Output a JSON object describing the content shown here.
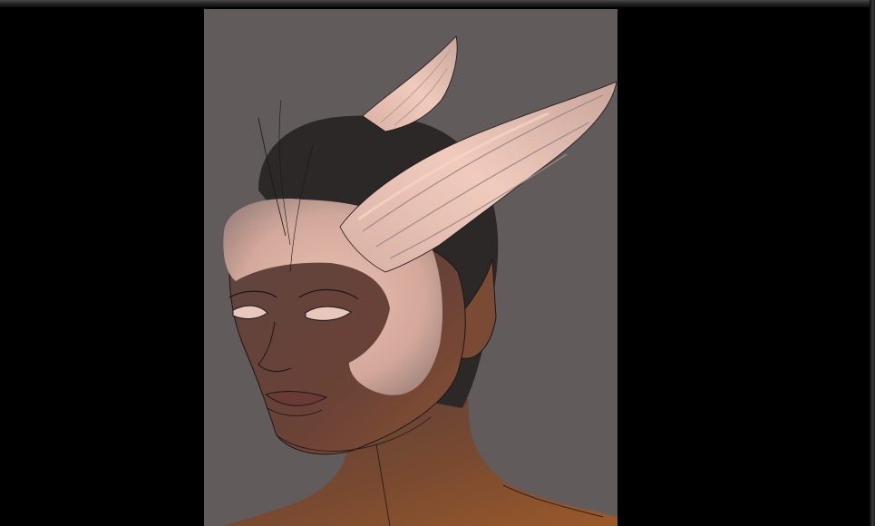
{
  "app": {
    "window_chrome_color": "#3a3a3a",
    "workspace_color": "#000000"
  },
  "canvas": {
    "background_color": "#625b5b",
    "artwork": "painting-winged-helmet-portrait",
    "colors": {
      "skin_dark": "#5a4038",
      "skin_warm": "#8a5232",
      "hair": "#2c2828",
      "wing_highlight": "#e9c1b4",
      "wing_shadow": "#a08a86",
      "line_art": "#1d1616"
    }
  }
}
